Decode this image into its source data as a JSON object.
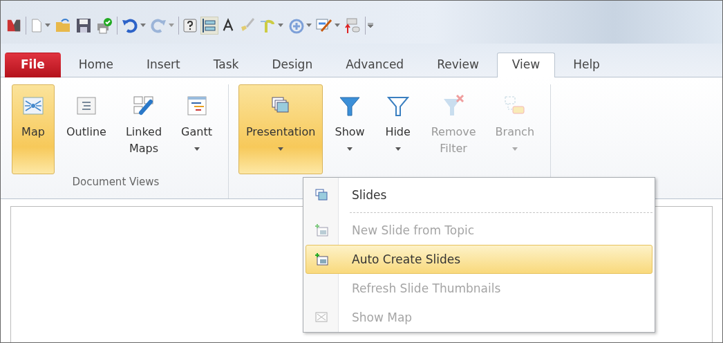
{
  "tabs": [
    {
      "label": "File",
      "kind": "file",
      "selected": false
    },
    {
      "label": "Home",
      "kind": "tab",
      "selected": false
    },
    {
      "label": "Insert",
      "kind": "tab",
      "selected": false
    },
    {
      "label": "Task",
      "kind": "tab",
      "selected": false
    },
    {
      "label": "Design",
      "kind": "tab",
      "selected": false
    },
    {
      "label": "Advanced",
      "kind": "tab",
      "selected": false
    },
    {
      "label": "Review",
      "kind": "tab",
      "selected": false
    },
    {
      "label": "View",
      "kind": "tab",
      "selected": true
    },
    {
      "label": "Help",
      "kind": "tab",
      "selected": false
    }
  ],
  "groups": [
    {
      "label": "Document Views",
      "buttons": [
        {
          "label": "Map",
          "kind": "map",
          "selected": true,
          "dropdown": false,
          "disabled": false
        },
        {
          "label": "Outline",
          "kind": "outline",
          "selected": false,
          "dropdown": false,
          "disabled": false
        },
        {
          "label": "Linked Maps",
          "kind": "linked",
          "selected": false,
          "dropdown": false,
          "disabled": false
        },
        {
          "label": "Gantt",
          "kind": "gantt",
          "selected": false,
          "dropdown": true,
          "disabled": false
        }
      ]
    },
    {
      "buttons": [
        {
          "label": "Presentation",
          "kind": "presentation",
          "selected": true,
          "dropdown": true,
          "disabled": false
        },
        {
          "label": "Show",
          "kind": "show",
          "selected": false,
          "dropdown": true,
          "disabled": false
        },
        {
          "label": "Hide",
          "kind": "hide",
          "selected": false,
          "dropdown": true,
          "disabled": false
        },
        {
          "label": "Remove Filter",
          "kind": "remove",
          "selected": false,
          "dropdown": false,
          "disabled": true
        },
        {
          "label": "Branch",
          "kind": "branch",
          "selected": false,
          "dropdown": true,
          "disabled": true
        }
      ]
    }
  ],
  "menu": {
    "items": [
      {
        "label": "Slides",
        "kind": "slides",
        "disabled": false,
        "selected": false,
        "separator_after": true
      },
      {
        "label": "New Slide from Topic",
        "kind": "newslide",
        "disabled": true,
        "selected": false,
        "separator_after": false
      },
      {
        "label": "Auto Create Slides",
        "kind": "newslide",
        "disabled": false,
        "selected": true,
        "separator_after": false
      },
      {
        "label": "Refresh Slide Thumbnails",
        "kind": "none",
        "disabled": true,
        "selected": false,
        "separator_after": false
      },
      {
        "label": "Show Map",
        "kind": "map",
        "disabled": true,
        "selected": false,
        "separator_after": false
      }
    ]
  }
}
